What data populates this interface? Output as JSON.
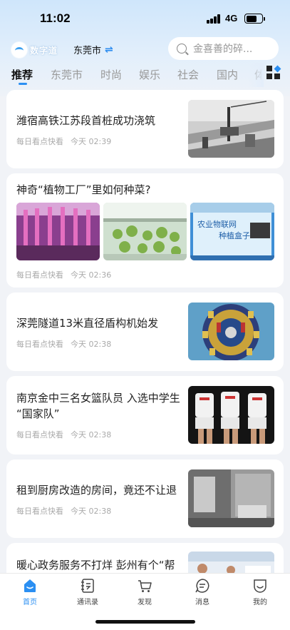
{
  "status_bar": {
    "time": "11:02",
    "network": "4G"
  },
  "top_bar": {
    "logo_text": "数字道",
    "city": "东莞市",
    "search_placeholder": "金喜善的碎..."
  },
  "tabs": [
    {
      "label": "推荐",
      "active": true
    },
    {
      "label": "东莞市",
      "active": false
    },
    {
      "label": "时尚",
      "active": false
    },
    {
      "label": "娱乐",
      "active": false
    },
    {
      "label": "社会",
      "active": false
    },
    {
      "label": "国内",
      "active": false
    },
    {
      "label": "体",
      "active": false
    }
  ],
  "feed": [
    {
      "title": "潍宿高铁江苏段首桩成功浇筑",
      "source": "每日看点快看",
      "time": "今天 02:39"
    },
    {
      "title": "神奇“植物工厂”里如何种菜?",
      "source": "每日看点快看",
      "time": "今天 02:36",
      "image_text": [
        "农业物联网",
        "种植盒子"
      ]
    },
    {
      "title": "深莞隧道13米直径盾构机始发",
      "source": "每日看点快看",
      "time": "今天 02:38"
    },
    {
      "title_line1": "南京金中三名女篮队员 入选中学生",
      "title_line2": "“国家队”",
      "source": "每日看点快看",
      "time": "今天 02:38"
    },
    {
      "title": "租到厨房改造的房间，竟还不让退",
      "source": "每日看点快看",
      "time": "今天 02:38"
    },
    {
      "title": "暖心政务服务不打烊 彭州有个“帮"
    }
  ],
  "bottom_nav": [
    {
      "label": "首页",
      "icon": "home-icon",
      "active": true
    },
    {
      "label": "通讯录",
      "icon": "contacts-icon",
      "active": false
    },
    {
      "label": "发现",
      "icon": "cart-icon",
      "active": false
    },
    {
      "label": "消息",
      "icon": "message-icon",
      "active": false
    },
    {
      "label": "我的",
      "icon": "profile-icon",
      "active": false
    }
  ],
  "colors": {
    "accent": "#2b8ff2",
    "background": "#f1f3f7"
  }
}
